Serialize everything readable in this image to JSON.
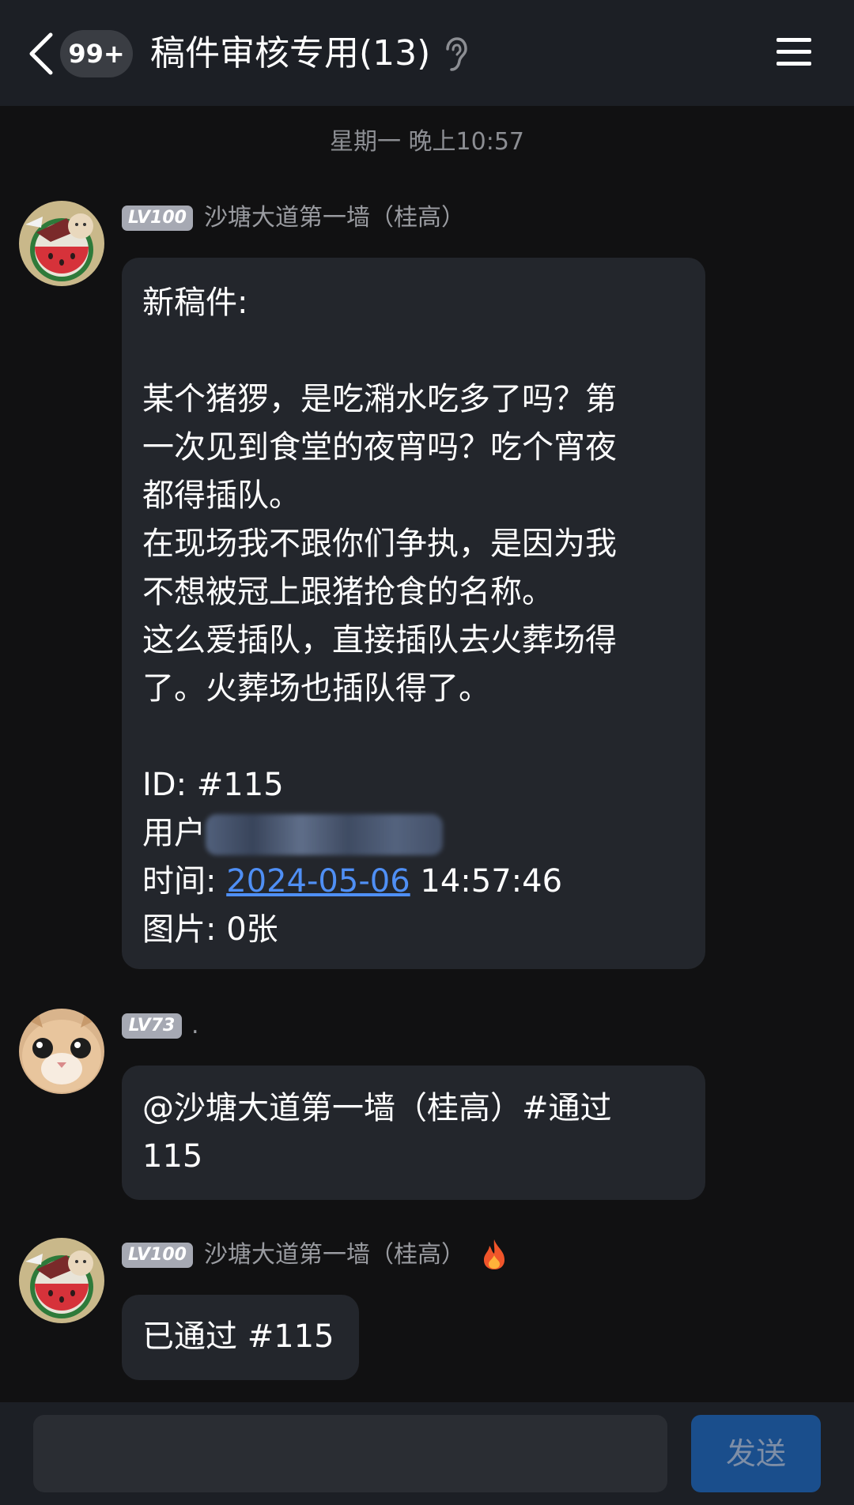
{
  "header": {
    "unread_count": "99+",
    "title": "稿件审核专用(13)",
    "back_icon": "chevron-left-icon",
    "earpiece_icon": "ear-icon",
    "menu_icon": "hamburger-menu-icon"
  },
  "timestamp": "星期一 晚上10:57",
  "messages": [
    {
      "level": "LV100",
      "sender": "沙塘大道第一墙（桂高）",
      "lines": [
        "新稿件:",
        "",
        "某个猪猡，是吃潲水吃多了吗？第",
        "一次见到食堂的夜宵吗？吃个宵夜",
        "都得插队。",
        "在现场我不跟你们争执，是因为我",
        "不想被冠上跟猪抢食的名称。",
        "这么爱插队，直接插队去火葬场得",
        "了。火葬场也插队得了。",
        "",
        "ID: #115"
      ],
      "user_label": "用户",
      "time_label": "时间: ",
      "time_date": "2024-05-06",
      "time_clock": " 14:57:46",
      "images_line": "图片: 0张"
    },
    {
      "level": "LV73",
      "sender": ".",
      "lines": [
        "@沙塘大道第一墙（桂高）#通过",
        "115"
      ]
    },
    {
      "level": "LV100",
      "sender": "沙塘大道第一墙（桂高）",
      "sender_icon": "fire-icon",
      "lines": [
        "已通过 #115"
      ]
    }
  ],
  "input": {
    "placeholder": "",
    "send_label": "发送"
  },
  "colors": {
    "background": "#111112",
    "header": "#1c1f25",
    "bubble": "#23262c",
    "link": "#4f8ff5",
    "send_button": "#1a4e8c"
  }
}
